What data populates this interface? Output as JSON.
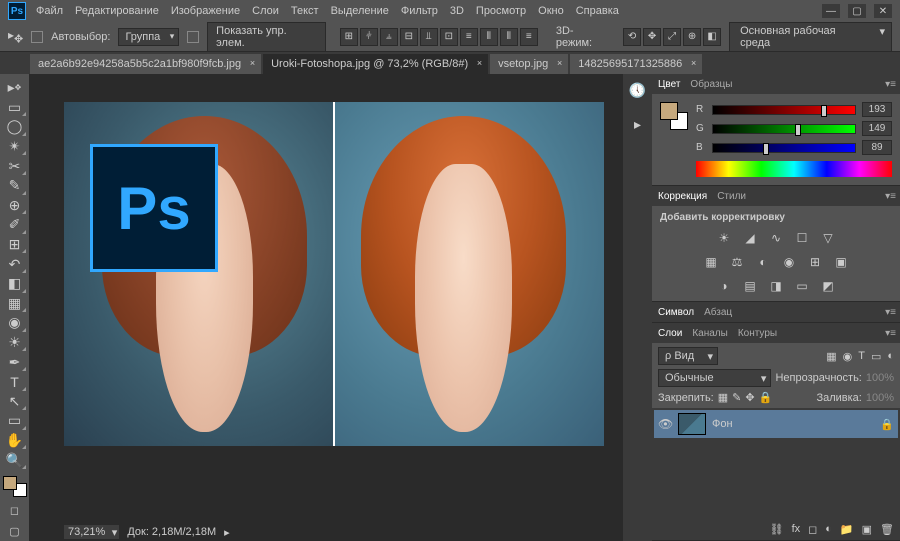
{
  "menu": [
    "Файл",
    "Редактирование",
    "Изображение",
    "Слои",
    "Текст",
    "Выделение",
    "Фильтр",
    "3D",
    "Просмотр",
    "Окно",
    "Справка"
  ],
  "options": {
    "autoselect": "Автовыбор:",
    "group": "Группа",
    "showControls": "Показать упр. элем.",
    "mode3d": "3D-режим:",
    "workspace": "Основная рабочая среда"
  },
  "tabs": [
    {
      "label": "ae2a6b92e94258a5b5c2a1bf980f9fcb.jpg",
      "active": false
    },
    {
      "label": "Uroki-Fotoshopa.jpg @ 73,2% (RGB/8#)",
      "active": true
    },
    {
      "label": "vsetop.jpg",
      "active": false
    },
    {
      "label": "14825695171325886",
      "active": false
    }
  ],
  "status": {
    "zoom": "73,21%",
    "doc": "Док: 2,18M/2,18M"
  },
  "panels": {
    "colorTab": "Цвет",
    "swatchTab": "Образцы",
    "r": {
      "label": "R",
      "val": "193",
      "pct": 76
    },
    "g": {
      "label": "G",
      "val": "149",
      "pct": 58
    },
    "b": {
      "label": "B",
      "val": "89",
      "pct": 35
    },
    "adjustTab": "Коррекция",
    "stylesTab": "Стили",
    "addAdjust": "Добавить корректировку",
    "symbolTab": "Символ",
    "paragraphTab": "Абзац",
    "layersTab": "Слои",
    "channelsTab": "Каналы",
    "pathsTab": "Контуры",
    "kind": "ρ Вид",
    "blend": "Обычные",
    "opacityLabel": "Непрозрачность:",
    "opacity": "100%",
    "lockLabel": "Закрепить:",
    "fillLabel": "Заливка:",
    "fill": "100%",
    "layerName": "Фон"
  },
  "psBadge": "Ps"
}
